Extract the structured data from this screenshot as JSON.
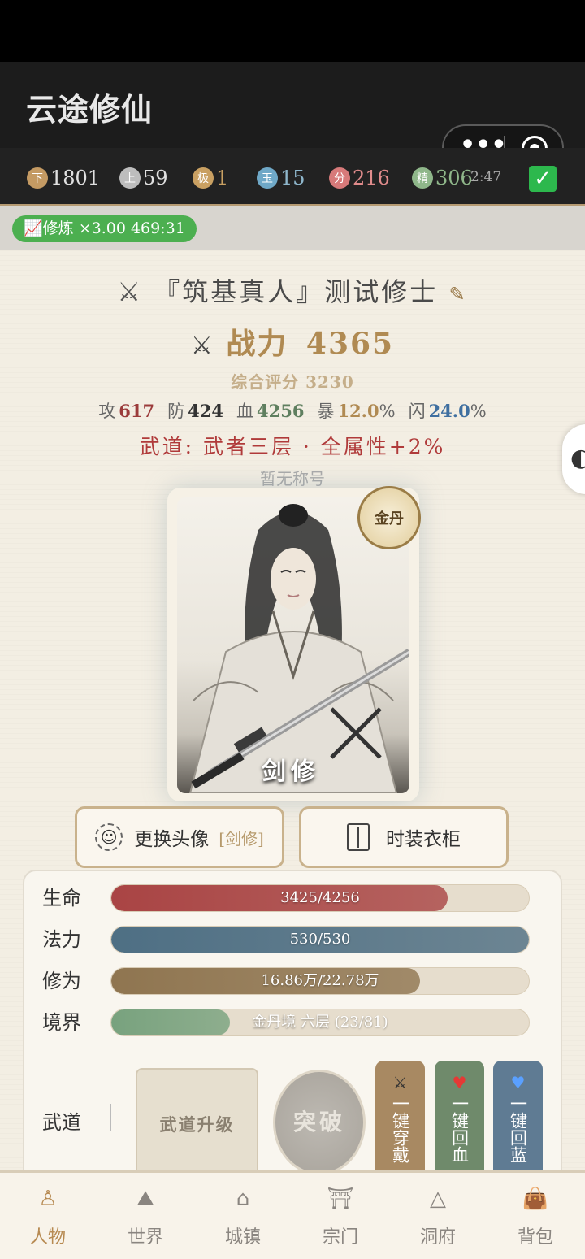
{
  "app": {
    "title": "云途修仙"
  },
  "currencies": [
    {
      "icon_char": "下",
      "value": "1801",
      "color": "#c49a63",
      "text_color": "#e0e0e0"
    },
    {
      "icon_char": "上",
      "value": "59",
      "color": "#bdbdbd",
      "text_color": "#e0e0e0"
    },
    {
      "icon_char": "极",
      "value": "1",
      "color": "#c9a062",
      "text_color": "#c9a062"
    },
    {
      "icon_char": "玉",
      "value": "15",
      "color": "#6fa8c7",
      "text_color": "#8fb7cc"
    },
    {
      "icon_char": "分",
      "value": "216",
      "color": "#d77a7a",
      "text_color": "#e08b8b"
    },
    {
      "icon_char": "精",
      "value": "306",
      "color": "#8fb78a",
      "text_color": "#8fb78a"
    }
  ],
  "timer": "2:47",
  "training": {
    "label": "📈修炼 ×3.00 469:31"
  },
  "profile": {
    "name": "『筑基真人』测试修士",
    "power_label": "战力",
    "power_value": "4365",
    "score": "综合评分 3230",
    "stats": [
      {
        "label": "攻",
        "value": "617",
        "unit": "",
        "color": "#9b3b3b"
      },
      {
        "label": "防",
        "value": "424",
        "unit": "",
        "color": "#333333"
      },
      {
        "label": "血",
        "value": "4256",
        "unit": "",
        "color": "#5f7f5f"
      },
      {
        "label": "暴",
        "value": "12.0",
        "unit": "%",
        "color": "#b08a52"
      },
      {
        "label": "闪",
        "value": "24.0",
        "unit": "%",
        "color": "#3f6fa0"
      }
    ],
    "wudao": "武道: 武者三层 · 全属性+2%",
    "title_text": "暂无称号",
    "role": "剑修",
    "realm_badge": "金丹"
  },
  "buttons": {
    "change_avatar": "更换头像",
    "change_avatar_sub": "[剑修]",
    "wardrobe": "时装衣柜"
  },
  "bars": [
    {
      "label": "生命",
      "text": "3425/4256",
      "fraction": 0.805,
      "color": "#a94444"
    },
    {
      "label": "法力",
      "text": "530/530",
      "fraction": 1.0,
      "color": "#4e6f84"
    },
    {
      "label": "修为",
      "text": "16.86万/22.78万",
      "fraction": 0.74,
      "color": "#8f7550"
    },
    {
      "label": "境界",
      "text": "金丹境 六层 (23/81)",
      "fraction": 0.284,
      "color": "#78a27e"
    }
  ],
  "wudao_panel": {
    "label": "武道",
    "upgrade": "武道升级",
    "breakthrough": "突破",
    "quick_equip": "一键穿戴",
    "quick_heal": "一键回血",
    "quick_mana": "一键回蓝"
  },
  "nav": [
    {
      "label": "人物",
      "icon": "person-icon",
      "glyph": "♙",
      "active": true
    },
    {
      "label": "世界",
      "icon": "mountain-chart-icon",
      "glyph": "⛰",
      "active": false
    },
    {
      "label": "城镇",
      "icon": "building-icon",
      "glyph": "⌂",
      "active": false
    },
    {
      "label": "宗门",
      "icon": "gate-icon",
      "glyph": "⛩",
      "active": false
    },
    {
      "label": "洞府",
      "icon": "cave-icon",
      "glyph": "△",
      "active": false
    },
    {
      "label": "背包",
      "icon": "bag-icon",
      "glyph": "👜",
      "active": false
    }
  ]
}
